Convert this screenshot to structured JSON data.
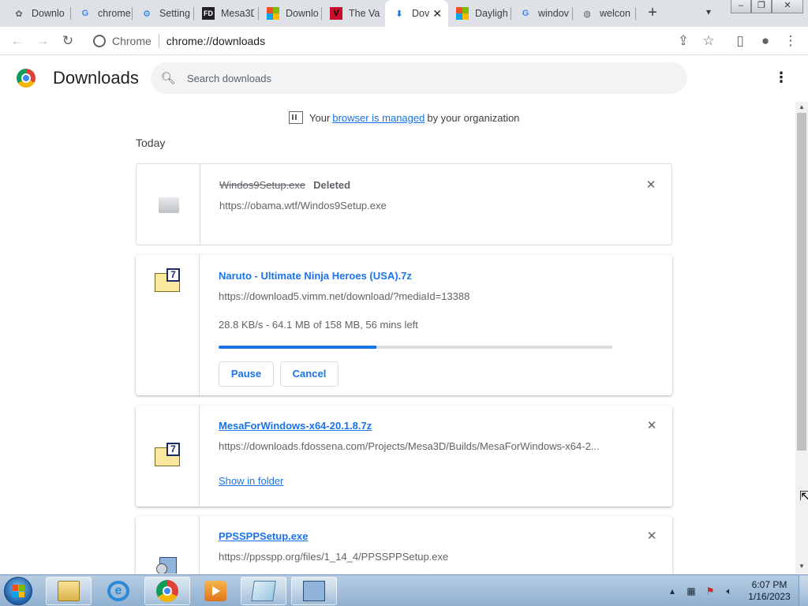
{
  "tabs": [
    {
      "title": "Downlo",
      "icon": "gear-flower-icon",
      "color": "#5f6368"
    },
    {
      "title": "chrome",
      "icon": "google-icon",
      "color": "#4285f4"
    },
    {
      "title": "Setting",
      "icon": "settings-icon",
      "color": "#1a73e8"
    },
    {
      "title": "Mesa3D",
      "icon": "fd-icon",
      "color": "#202124"
    },
    {
      "title": "Downlo",
      "icon": "microsoft-icon",
      "color": "#f25022"
    },
    {
      "title": "The Va",
      "icon": "v-icon",
      "color": "#c8102e"
    },
    {
      "title": "Dov",
      "icon": "download-icon",
      "color": "#1a73e8",
      "active": true
    },
    {
      "title": "Dayligh",
      "icon": "microsoft-icon",
      "color": "#f25022"
    },
    {
      "title": "windov",
      "icon": "google-icon",
      "color": "#4285f4"
    },
    {
      "title": "welcon",
      "icon": "globe-icon",
      "color": "#5f6368"
    }
  ],
  "omnibox": {
    "site": "Chrome",
    "url": "chrome://downloads"
  },
  "page": {
    "title": "Downloads",
    "search_placeholder": "Search downloads"
  },
  "managed": {
    "prefix": "Your",
    "link": "browser is managed",
    "suffix": "by your organization"
  },
  "section_label": "Today",
  "downloads": [
    {
      "name": "Windos9Setup.exe",
      "status": "Deleted",
      "url": "https://obama.wtf/Windos9Setup.exe"
    },
    {
      "name": "Naruto - Ultimate Ninja Heroes (USA).7z",
      "url": "https://download5.vimm.net/download/?mediaId=13388",
      "progress_text": "28.8 KB/s - 64.1 MB of 158 MB, 56 mins left",
      "progress_fraction": 0.4,
      "pause_label": "Pause",
      "cancel_label": "Cancel",
      "badge": "7"
    },
    {
      "name": "MesaForWindows-x64-20.1.8.7z",
      "url": "https://downloads.fdossena.com/Projects/Mesa3D/Builds/MesaForWindows-x64-2...",
      "show_in_folder": "Show in folder",
      "badge": "7"
    },
    {
      "name": "PPSSPPSetup.exe",
      "url": "https://ppsspp.org/files/1_14_4/PPSSPPSetup.exe"
    }
  ],
  "taskbar": {
    "apps": [
      "file-explorer-icon",
      "internet-explorer-icon",
      "chrome-icon",
      "media-player-icon",
      "notepad-icon",
      "setup-icon"
    ],
    "time": "6:07 PM",
    "date": "1/16/2023"
  },
  "colors": {
    "accent": "#1a73e8",
    "tab_strip": "#dee1e6"
  }
}
